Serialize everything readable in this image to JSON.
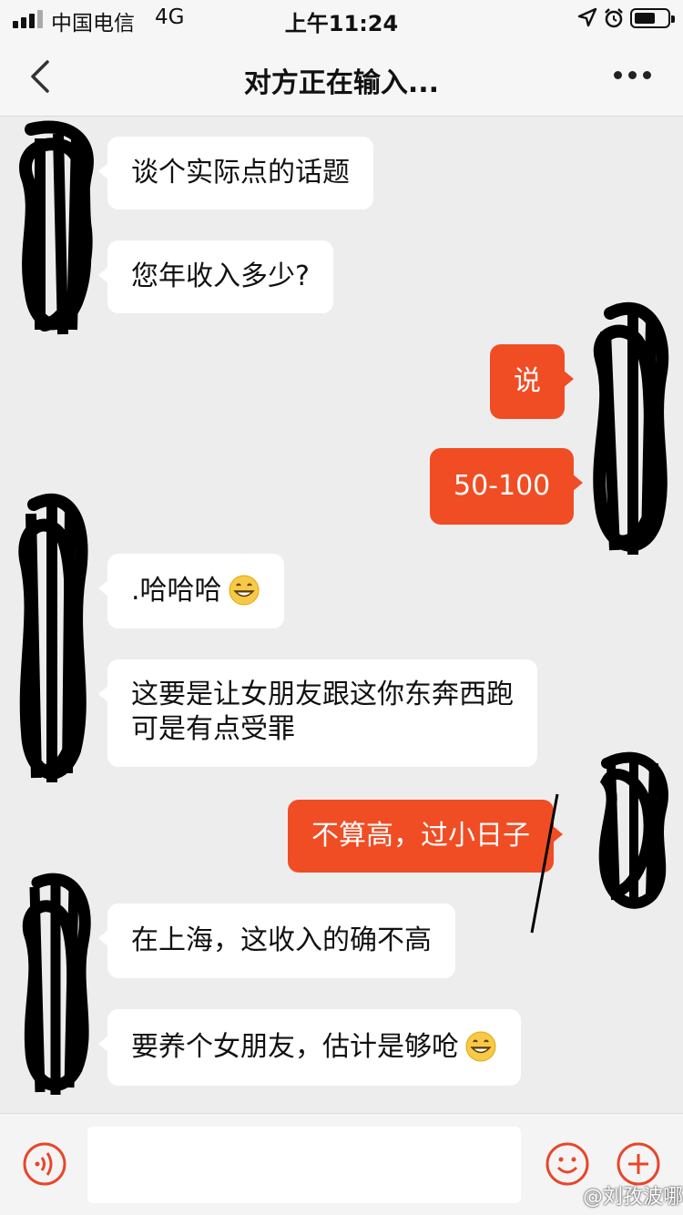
{
  "status_bar": {
    "carrier": "中国电信",
    "network": "4G",
    "time": "上午11:24"
  },
  "nav": {
    "title": "对方正在输入..."
  },
  "messages": [
    {
      "side": "in",
      "text": "谈个实际点的话题"
    },
    {
      "side": "in",
      "text": "您年收入多少?"
    },
    {
      "side": "out",
      "text": "说"
    },
    {
      "side": "out",
      "text": "50-100"
    },
    {
      "side": "in",
      "text": ".哈哈哈",
      "emoji": "grin-emoji"
    },
    {
      "side": "in",
      "lines": [
        "这要是让女朋友跟这你东奔西跑",
        "可是有点受罪"
      ]
    },
    {
      "side": "out",
      "text": "不算高，过小日子"
    },
    {
      "side": "in",
      "text": "在上海，这收入的确不高"
    },
    {
      "side": "in",
      "text": "要养个女朋友，估计是够呛",
      "emoji": "grin-emoji"
    }
  ],
  "input_bar": {
    "voice_icon": "voice-icon",
    "emoji_icon": "emoji-icon",
    "plus_icon": "plus-icon"
  },
  "watermark": "@刘孜波哪",
  "colors": {
    "outgoing_bubble": "#f04d24",
    "incoming_bubble": "#ffffff",
    "chat_background": "#eeedee"
  }
}
